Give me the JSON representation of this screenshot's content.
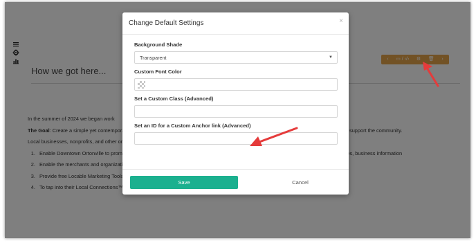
{
  "page": {
    "heading": "How we got here...",
    "intro": "In the summer of 2024 we began work",
    "goal_label": "The Goal",
    "goal_text": ": Create a simple yet contemporary site that would allow Downtown Ortonville to promote merchants, local events and activities, and support the community.",
    "partners": "Local businesses, nonprofits, and other organizations would benefit from the site, which would provide the following primary benefits:",
    "list": [
      "Enable Downtown Ortonville to promote merchants, organizations, and the community by sharing events, offers/coupons, job opportunities, business information",
      "Enable the merchants and organizations to share their content with the rest of the community - automatically",
      "Provide free Locable Marketing Tools to enable merchants and organizations to promote themselves online",
      "To tap into their Local Connections™ to drive exposure, reach, and referrals through other local organizations in the region"
    ]
  },
  "toolbar": {
    "left_arrow": "‹",
    "media_glyph": "▭ / ‹/›",
    "gear": "⚙",
    "trash": "🗑",
    "right_arrow": "›"
  },
  "modal": {
    "title": "Change Default Settings",
    "close": "×",
    "fields": {
      "background_shade_label": "Background Shade",
      "background_shade_value": "Transparent",
      "font_color_label": "Custom Font Color",
      "class_label": "Set a Custom Class (Advanced)",
      "class_value": "",
      "anchor_label": "Set an ID for a Custom Anchor link (Advanced)",
      "anchor_value": ""
    },
    "save_label": "Save",
    "cancel_label": "Cancel"
  },
  "colors": {
    "save_button": "#1bb08f",
    "toolbar": "#e5a44a",
    "annotation_arrow": "#e53b3b",
    "overlay": "rgba(0,0,0,0.5)"
  }
}
